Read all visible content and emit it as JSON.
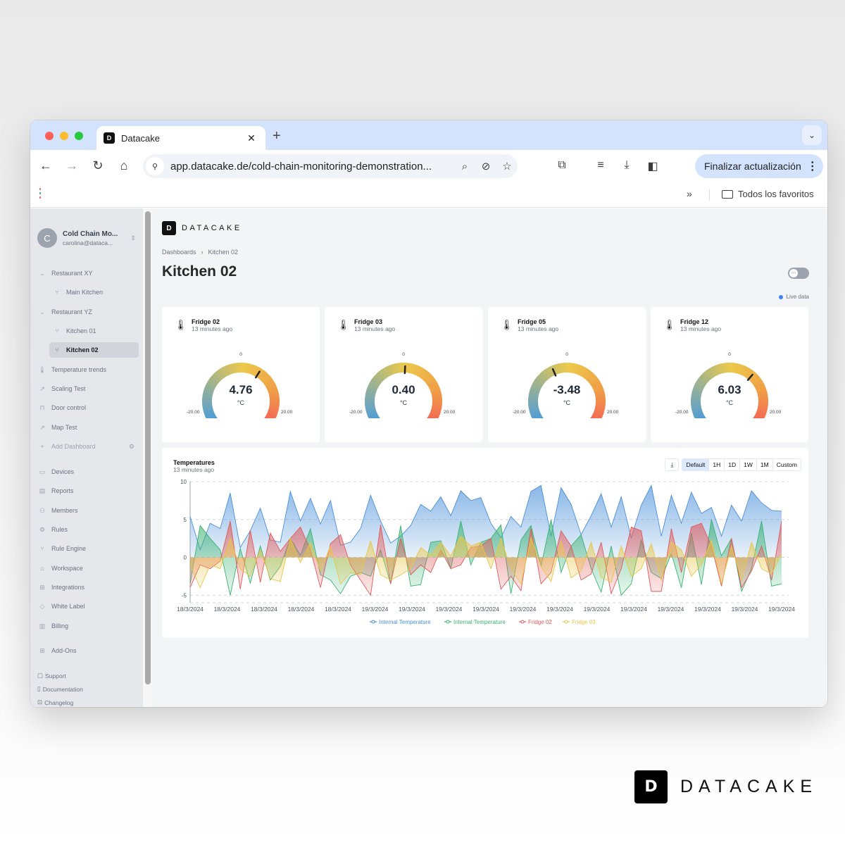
{
  "browser": {
    "tab_title": "Datacake",
    "url": "app.datacake.de/cold-chain-monitoring-demonstration...",
    "update_button": "Finalizar actualización",
    "bookmarks_all": "Todos los favoritos",
    "icons": {
      "back": "←",
      "forward": "→",
      "reload": "↻",
      "home": "⌂",
      "close": "✕",
      "newtab": "+",
      "tabsearch": "⌄",
      "tune": "⚲",
      "zoom": "🔍︎",
      "eyeoff": "⊘",
      "star": "☆",
      "extensions": "⧉",
      "media": "≡",
      "download": "⤓",
      "sidepanel": "◧",
      "more": "⋮",
      "chevrons": "»"
    }
  },
  "account": {
    "initial": "C",
    "name": "Cold Chain Mo...",
    "email": "carolina@dataca..."
  },
  "sidebar": {
    "groups": [
      {
        "label": "Restaurant XY",
        "icon": "⌄"
      },
      {
        "label": "Restaurant YZ",
        "icon": "⌄"
      }
    ],
    "dashboards": [
      {
        "label": "Main Kitchen",
        "icon": "⑂"
      },
      {
        "label": "Kitchen 01",
        "icon": "⑂"
      },
      {
        "label": "Kitchen 02",
        "icon": "⑂"
      },
      {
        "label": "Temperature trends",
        "icon": "🌡︎"
      },
      {
        "label": "Scaling Test",
        "icon": "↗"
      },
      {
        "label": "Door control",
        "icon": "⊓"
      },
      {
        "label": "Map Test",
        "icon": "↗"
      },
      {
        "label": "Add Dashboard",
        "icon": "+"
      }
    ],
    "menu": [
      {
        "label": "Devices",
        "icon": "▭"
      },
      {
        "label": "Reports",
        "icon": "▤"
      },
      {
        "label": "Members",
        "icon": "⚇"
      },
      {
        "label": "Rules",
        "icon": "⚙"
      },
      {
        "label": "Rule Engine",
        "icon": "⑂"
      },
      {
        "label": "Workspace",
        "icon": "⌂"
      },
      {
        "label": "Integrations",
        "icon": "⊞"
      },
      {
        "label": "White Label",
        "icon": "◇"
      },
      {
        "label": "Billing",
        "icon": "▥"
      },
      {
        "label": "Add-Ons",
        "icon": "⊞"
      }
    ],
    "footer": [
      {
        "label": "Support",
        "icon": "▢"
      },
      {
        "label": "Documentation",
        "icon": "▯"
      },
      {
        "label": "Changelog",
        "icon": "⊡"
      }
    ],
    "gear_icon": "⚙"
  },
  "main": {
    "brand": "DATACAKE",
    "breadcrumb": [
      "Dashboards",
      "›",
      "Kitchen 02"
    ],
    "title": "Kitchen 02",
    "live_label": "Live data"
  },
  "gauges": [
    {
      "name": "Fridge 02",
      "time": "13 minutes ago",
      "value": 4.76,
      "value_text": "4.76",
      "unit": "°C",
      "min": -20,
      "max": 20,
      "min_label": "-20.00",
      "max_label": "20.00",
      "zero_label": "0"
    },
    {
      "name": "Fridge 03",
      "time": "13 minutes ago",
      "value": 0.4,
      "value_text": "0.40",
      "unit": "°C",
      "min": -20,
      "max": 20,
      "min_label": "-20.00",
      "max_label": "20.00",
      "zero_label": "0"
    },
    {
      "name": "Fridge 05",
      "time": "13 minutes ago",
      "value": -3.48,
      "value_text": "-3.48",
      "unit": "°C",
      "min": -20,
      "max": 20,
      "min_label": "-20.00",
      "max_label": "20.00",
      "zero_label": "0"
    },
    {
      "name": "Fridge 12",
      "time": "13 minutes ago",
      "value": 6.03,
      "value_text": "6.03",
      "unit": "°C",
      "min": -20,
      "max": 20,
      "min_label": "-20.00",
      "max_label": "20.00",
      "zero_label": "0"
    }
  ],
  "chart_panel": {
    "title": "Temperatures",
    "time": "13 minutes ago",
    "download_icon": "⤓",
    "ranges": [
      {
        "label": "Default",
        "active": true
      },
      {
        "label": "1H",
        "active": false
      },
      {
        "label": "1D",
        "active": false
      },
      {
        "label": "1W",
        "active": false
      },
      {
        "label": "1M",
        "active": false
      },
      {
        "label": "Custom",
        "active": false
      }
    ]
  },
  "chart_data": {
    "type": "area",
    "title": "Temperatures",
    "xlabel": "",
    "ylabel": "",
    "ylim": [
      -6,
      10
    ],
    "yticks": [
      -5,
      0,
      5,
      10
    ],
    "grid": true,
    "legend": "bottom",
    "x_tick_labels": [
      "18/3/2024",
      "18/3/2024",
      "18/3/2024",
      "18/3/2024",
      "18/3/2024",
      "19/3/2024",
      "19/3/2024",
      "19/3/2024",
      "19/3/2024",
      "19/3/2024",
      "19/3/2024",
      "19/3/2024",
      "19/3/2024",
      "19/3/2024",
      "19/3/2024",
      "19/3/2024",
      "19/3/2024"
    ],
    "series": [
      {
        "name": "Internal Temperature",
        "color": "#4a90d9",
        "values": [
          5.4,
          1.0,
          4.5,
          3.8,
          8.5,
          1.3,
          3.5,
          6.5,
          2.3,
          2.0,
          8.7,
          4.8,
          7.8,
          4.4,
          7.5,
          1.6,
          2.0,
          3.8,
          8.2,
          4.8,
          1.9,
          2.8,
          4.2,
          7.0,
          6.1,
          8.0,
          5.5,
          8.8,
          7.5,
          7.9,
          4.5,
          2.6,
          5.4,
          4.0,
          8.7,
          9.5,
          2.8,
          9.2,
          7.0,
          3.0,
          5.5,
          8.4,
          4.0,
          8.0,
          2.6,
          6.9,
          9.5,
          2.8,
          8.2,
          4.5,
          8.6,
          5.8,
          6.6,
          2.8,
          6.9,
          4.8,
          8.8,
          7.2,
          6.2,
          6.1
        ]
      },
      {
        "name": "Internal Temperature",
        "color": "#3bb273",
        "values": [
          -3.5,
          4.2,
          2.5,
          1.0,
          -5.0,
          1.2,
          -3.4,
          1.5,
          -3.0,
          -1.2,
          2.5,
          0.3,
          3.8,
          -2.3,
          -3.0,
          -4.8,
          -2.5,
          -2.0,
          -2.5,
          1.0,
          -3.5,
          4.2,
          -3.8,
          -3.6,
          2.0,
          2.2,
          -1.5,
          4.8,
          -1.0,
          2.0,
          2.5,
          4.3,
          -4.8,
          2.3,
          4.2,
          -1.2,
          5.0,
          -2.0,
          1.5,
          3.0,
          -1.5,
          -4.6,
          1.5,
          -5.0,
          -3.5,
          2.3,
          -2.0,
          -2.8,
          0.5,
          -4.0,
          3.2,
          -3.6,
          5.0,
          0.2,
          2.5,
          -4.5,
          -1.5,
          4.8,
          -3.8,
          -3.5
        ]
      },
      {
        "name": "Fridge 02",
        "color": "#e05a5a",
        "values": [
          -4.0,
          -1.0,
          -1.5,
          -0.5,
          4.8,
          -4.2,
          3.6,
          -3.3,
          3.2,
          0.8,
          2.5,
          4.0,
          1.0,
          -4.0,
          1.8,
          3.0,
          -1.0,
          -3.0,
          -5.0,
          4.3,
          -3.5,
          2.5,
          -2.3,
          -1.0,
          -2.0,
          1.0,
          -1.5,
          -1.0,
          1.3,
          1.5,
          2.5,
          -4.2,
          -2.5,
          -4.4,
          3.8,
          -3.5,
          -2.0,
          3.5,
          1.5,
          -3.0,
          -2.2,
          2.0,
          -4.8,
          -1.5,
          4.0,
          3.5,
          -4.5,
          -4.5,
          3.8,
          -2.0,
          4.0,
          4.5,
          1.5,
          -3.8,
          2.5,
          -4.0,
          -1.8,
          1.5,
          -3.0,
          4.8
        ]
      },
      {
        "name": "Fridge 03",
        "color": "#e8c547",
        "values": [
          -1.0,
          -4.0,
          -1.0,
          -1.5,
          2.5,
          -1.5,
          -2.5,
          1.0,
          -2.8,
          -3.2,
          2.5,
          -0.7,
          2.0,
          -1.8,
          1.5,
          -3.5,
          -2.0,
          -2.3,
          2.2,
          -2.3,
          -3.0,
          -2.3,
          -1.5,
          1.3,
          0.3,
          2.0,
          0.2,
          2.8,
          1.5,
          2.0,
          -1.5,
          2.5,
          -1.5,
          -3.5,
          2.6,
          -1.2,
          -3.2,
          2.2,
          -2.7,
          -1.8,
          2.0,
          -2.6,
          -3.3,
          1.5,
          -2.5,
          -1.5,
          1.8,
          -3.0,
          2.0,
          1.0,
          -2.5,
          -1.0,
          2.3,
          -3.5,
          1.5,
          -3.0,
          2.0,
          -1.5,
          -2.2,
          0.5
        ]
      }
    ]
  },
  "bottom_brand": {
    "logo_glyph": "D",
    "text": "DATACAKE"
  }
}
